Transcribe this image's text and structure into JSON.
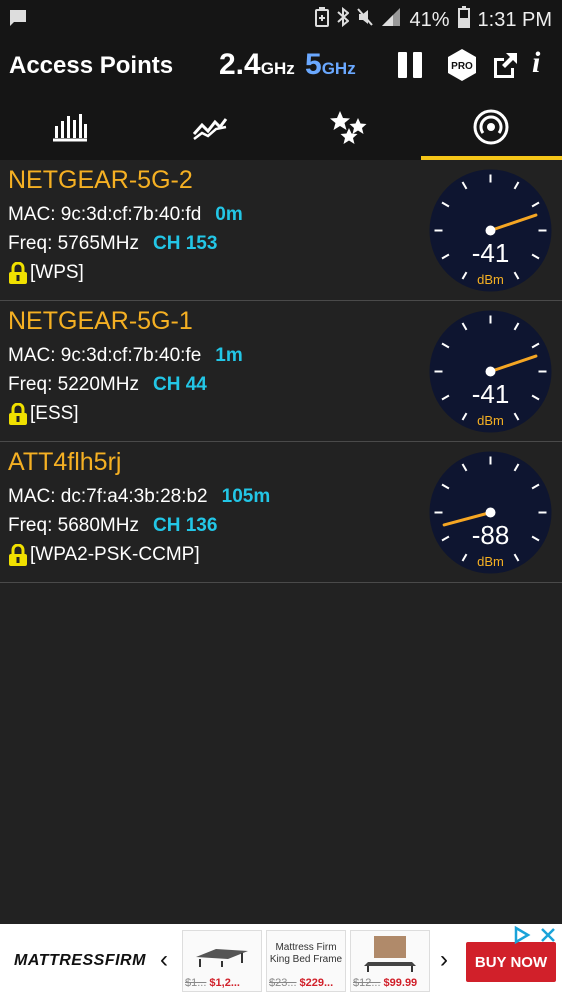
{
  "status_bar": {
    "battery_percent": "41%",
    "time": "1:31 PM"
  },
  "app_bar": {
    "title": "Access Points",
    "band_24": {
      "value": "2.4",
      "unit": "GHz"
    },
    "band_5": {
      "value": "5",
      "unit": "GHz"
    },
    "pro_badge": "PRO",
    "info_label": "i"
  },
  "tabs": [
    {
      "icon": "bar-graph-icon"
    },
    {
      "icon": "time-graph-icon"
    },
    {
      "icon": "channel-rating-icon"
    },
    {
      "icon": "access-points-icon",
      "selected": true
    }
  ],
  "access_points": [
    {
      "ssid": "NETGEAR-5G-2",
      "mac_label": "MAC:",
      "mac": "9c:3d:cf:7b:40:fd",
      "distance": "0m",
      "freq_label": "Freq:",
      "freq": "5765MHz",
      "channel": "CH 153",
      "security": "[WPS]",
      "dbm": -41,
      "dbm_text": "-41",
      "unit": "dBm"
    },
    {
      "ssid": "NETGEAR-5G-1",
      "mac_label": "MAC:",
      "mac": "9c:3d:cf:7b:40:fe",
      "distance": "1m",
      "freq_label": "Freq:",
      "freq": "5220MHz",
      "channel": "CH 44",
      "security": "[ESS]",
      "dbm": -41,
      "dbm_text": "-41",
      "unit": "dBm"
    },
    {
      "ssid": "ATT4flh5rj",
      "mac_label": "MAC:",
      "mac": "dc:7f:a4:3b:28:b2",
      "distance": "105m",
      "freq_label": "Freq:",
      "freq": "5680MHz",
      "channel": "CH 136",
      "security": "[WPA2-PSK-CCMP]",
      "dbm": -88,
      "dbm_text": "-88",
      "unit": "dBm"
    }
  ],
  "ad": {
    "brand": "MATTRESSFIRM",
    "cards": [
      {
        "caption": "",
        "old_price": "$1...",
        "new_price": "$1,2..."
      },
      {
        "caption": "Mattress Firm King Bed Frame",
        "old_price": "$23...",
        "new_price": "$229..."
      },
      {
        "caption": "",
        "old_price": "$12...",
        "new_price": "$99.99"
      }
    ],
    "cta": "BUY NOW"
  },
  "colors": {
    "ssid": "#f5b023",
    "accent_cyan": "#23c6e6",
    "band_5": "#6aa8ff",
    "tab_indicator": "#f5c518",
    "gauge_face": "#0e1530",
    "needle": "#f5a623",
    "ad_cta": "#d1202a"
  }
}
